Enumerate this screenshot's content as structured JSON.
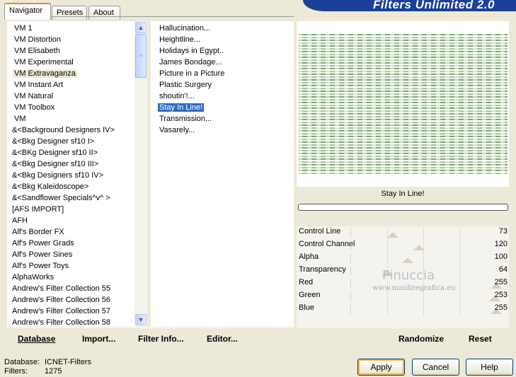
{
  "banner": {
    "title": "Filters Unlimited 2.0"
  },
  "tabs": [
    {
      "label": "Navigator",
      "active": true
    },
    {
      "label": "Presets",
      "active": false
    },
    {
      "label": "About",
      "active": false
    }
  ],
  "categories": {
    "items": [
      "VM 1",
      "VM Distortion",
      "VM Elisabeth",
      "VM Experimental",
      "VM Extravaganza",
      "VM Instant Art",
      "VM Natural",
      "VM Toolbox",
      "VM",
      "&<Background Designers IV>",
      "&<Bkg Designer sf10 I>",
      "&<BKg Designer sf10 II>",
      "&<Bkg Designer sf10 III>",
      "&<Bkg Designers sf10 IV>",
      "&<Bkg Kaleidoscope>",
      "&<Sandflower Specials^v^ >",
      "[AFS IMPORT]",
      "AFH",
      "Alf's Border FX",
      "Alf's Power Grads",
      "Alf's Power Sines",
      "Alf's Power Toys",
      "AlphaWorks",
      "Andrew's Filter Collection 55",
      "Andrew's Filter Collection 56",
      "Andrew's Filter Collection 57",
      "Andrew's Filter Collection 58"
    ],
    "selected": "VM Extravaganza"
  },
  "filters": {
    "items": [
      "Hallucination...",
      "Heightline...",
      "Holidays in Egypt..",
      "James Bondage...",
      "Picture in a Picture",
      "Plastic Surgery",
      "shoutin'!...",
      "Stay In Line!",
      "Transmission...",
      "Vasarely..."
    ],
    "selected": "Stay In Line!"
  },
  "actions": {
    "database": "Database",
    "import": "Import...",
    "filter_info": "Filter Info...",
    "editor": "Editor...",
    "randomize": "Randomize",
    "reset": "Reset"
  },
  "preview": {
    "filter_name": "Stay In Line!"
  },
  "params": [
    {
      "name": "Control Line",
      "value": 73
    },
    {
      "name": "Control Channel",
      "value": 120
    },
    {
      "name": "Alpha",
      "value": 100
    },
    {
      "name": "Transparency",
      "value": 64
    },
    {
      "name": "Red",
      "value": 255
    },
    {
      "name": "Green",
      "value": 253
    },
    {
      "name": "Blue",
      "value": 255
    }
  ],
  "watermark": {
    "name": "Pinuccia",
    "site": "www.maidiregrafica.eu"
  },
  "status": {
    "database_label": "Database:",
    "database_value": "ICNET-Filters",
    "filters_label": "Filters:",
    "filters_value": "1275"
  },
  "buttons": {
    "apply": "Apply",
    "cancel": "Cancel",
    "help": "Help"
  },
  "colors": {
    "banner": "#1c3f9a",
    "selection": "#316ac5",
    "default_button_glow": "#f8b347"
  }
}
